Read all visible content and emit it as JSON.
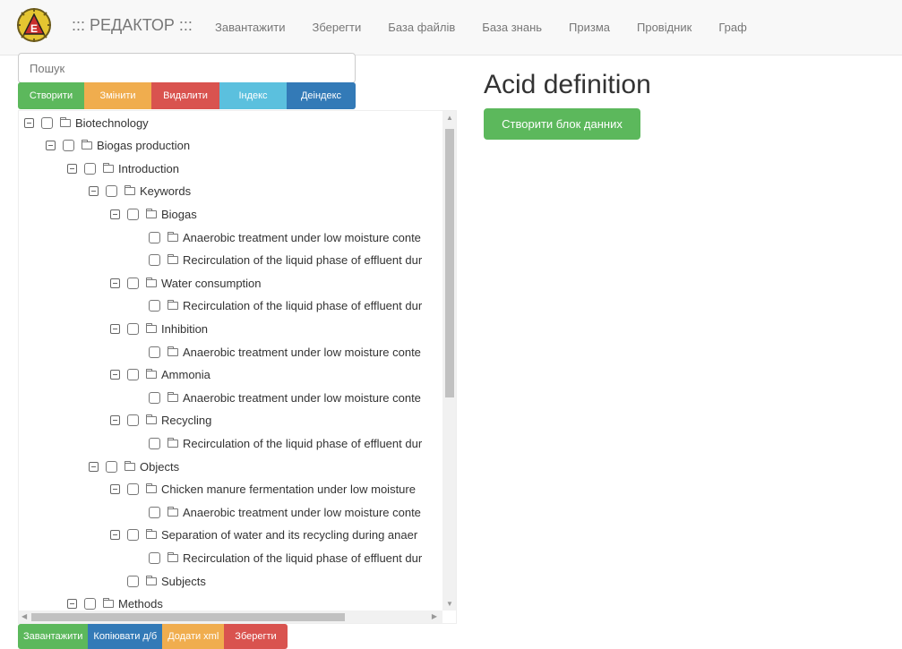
{
  "navbar": {
    "brand": "::: РЕДАКТОР :::",
    "links": [
      "Завантажити",
      "Зберегти",
      "База файлів",
      "База знань",
      "Призма",
      "Провідник",
      "Граф"
    ]
  },
  "search": {
    "placeholder": "Пошук",
    "value": ""
  },
  "actions": {
    "create": "Створити",
    "edit": "Змінити",
    "delete": "Видалити",
    "index": "Індекс",
    "deindex": "Деіндекс"
  },
  "tree": [
    {
      "label": "Biotechnology",
      "level": 0,
      "toggle": true
    },
    {
      "label": "Biogas production",
      "level": 1,
      "toggle": true
    },
    {
      "label": "Introduction",
      "level": 2,
      "toggle": true
    },
    {
      "label": "Keywords",
      "level": 3,
      "toggle": true
    },
    {
      "label": "Biogas",
      "level": 4,
      "toggle": true
    },
    {
      "label": "Anaerobic treatment under low moisture conte",
      "level": 5,
      "toggle": false
    },
    {
      "label": "Recirculation of the liquid phase of effluent dur",
      "level": 5,
      "toggle": false
    },
    {
      "label": "Water consumption",
      "level": 4,
      "toggle": true
    },
    {
      "label": "Recirculation of the liquid phase of effluent dur",
      "level": 5,
      "toggle": false
    },
    {
      "label": "Inhibition",
      "level": 4,
      "toggle": true
    },
    {
      "label": "Anaerobic treatment under low moisture conte",
      "level": 5,
      "toggle": false
    },
    {
      "label": "Ammonia",
      "level": 4,
      "toggle": true
    },
    {
      "label": "Anaerobic treatment under low moisture conte",
      "level": 5,
      "toggle": false
    },
    {
      "label": "Recycling",
      "level": 4,
      "toggle": true
    },
    {
      "label": "Recirculation of the liquid phase of effluent dur",
      "level": 5,
      "toggle": false
    },
    {
      "label": "Objects",
      "level": 3,
      "toggle": true
    },
    {
      "label": "Chicken manure fermentation under low moisture",
      "level": 4,
      "toggle": true
    },
    {
      "label": "Anaerobic treatment under low moisture conte",
      "level": 5,
      "toggle": false
    },
    {
      "label": "Separation of water and its recycling during anaer",
      "level": 4,
      "toggle": true
    },
    {
      "label": "Recirculation of the liquid phase of effluent dur",
      "level": 5,
      "toggle": false
    },
    {
      "label": "Subjects",
      "level": 4,
      "toggle": false
    },
    {
      "label": "Methods",
      "level": 2,
      "toggle": true
    }
  ],
  "bottom_actions": {
    "load": "Завантажити",
    "copy_db": "Копіювати д/б",
    "add_xml": "Додати xml",
    "save": "Зберегти"
  },
  "content": {
    "title": "Acid definition",
    "create_block": "Створити блок данних"
  },
  "colors": {
    "green": "#5cb85c",
    "orange": "#f0ad4e",
    "red": "#d9534f",
    "light_blue": "#5bc0de",
    "blue": "#337ab7"
  }
}
